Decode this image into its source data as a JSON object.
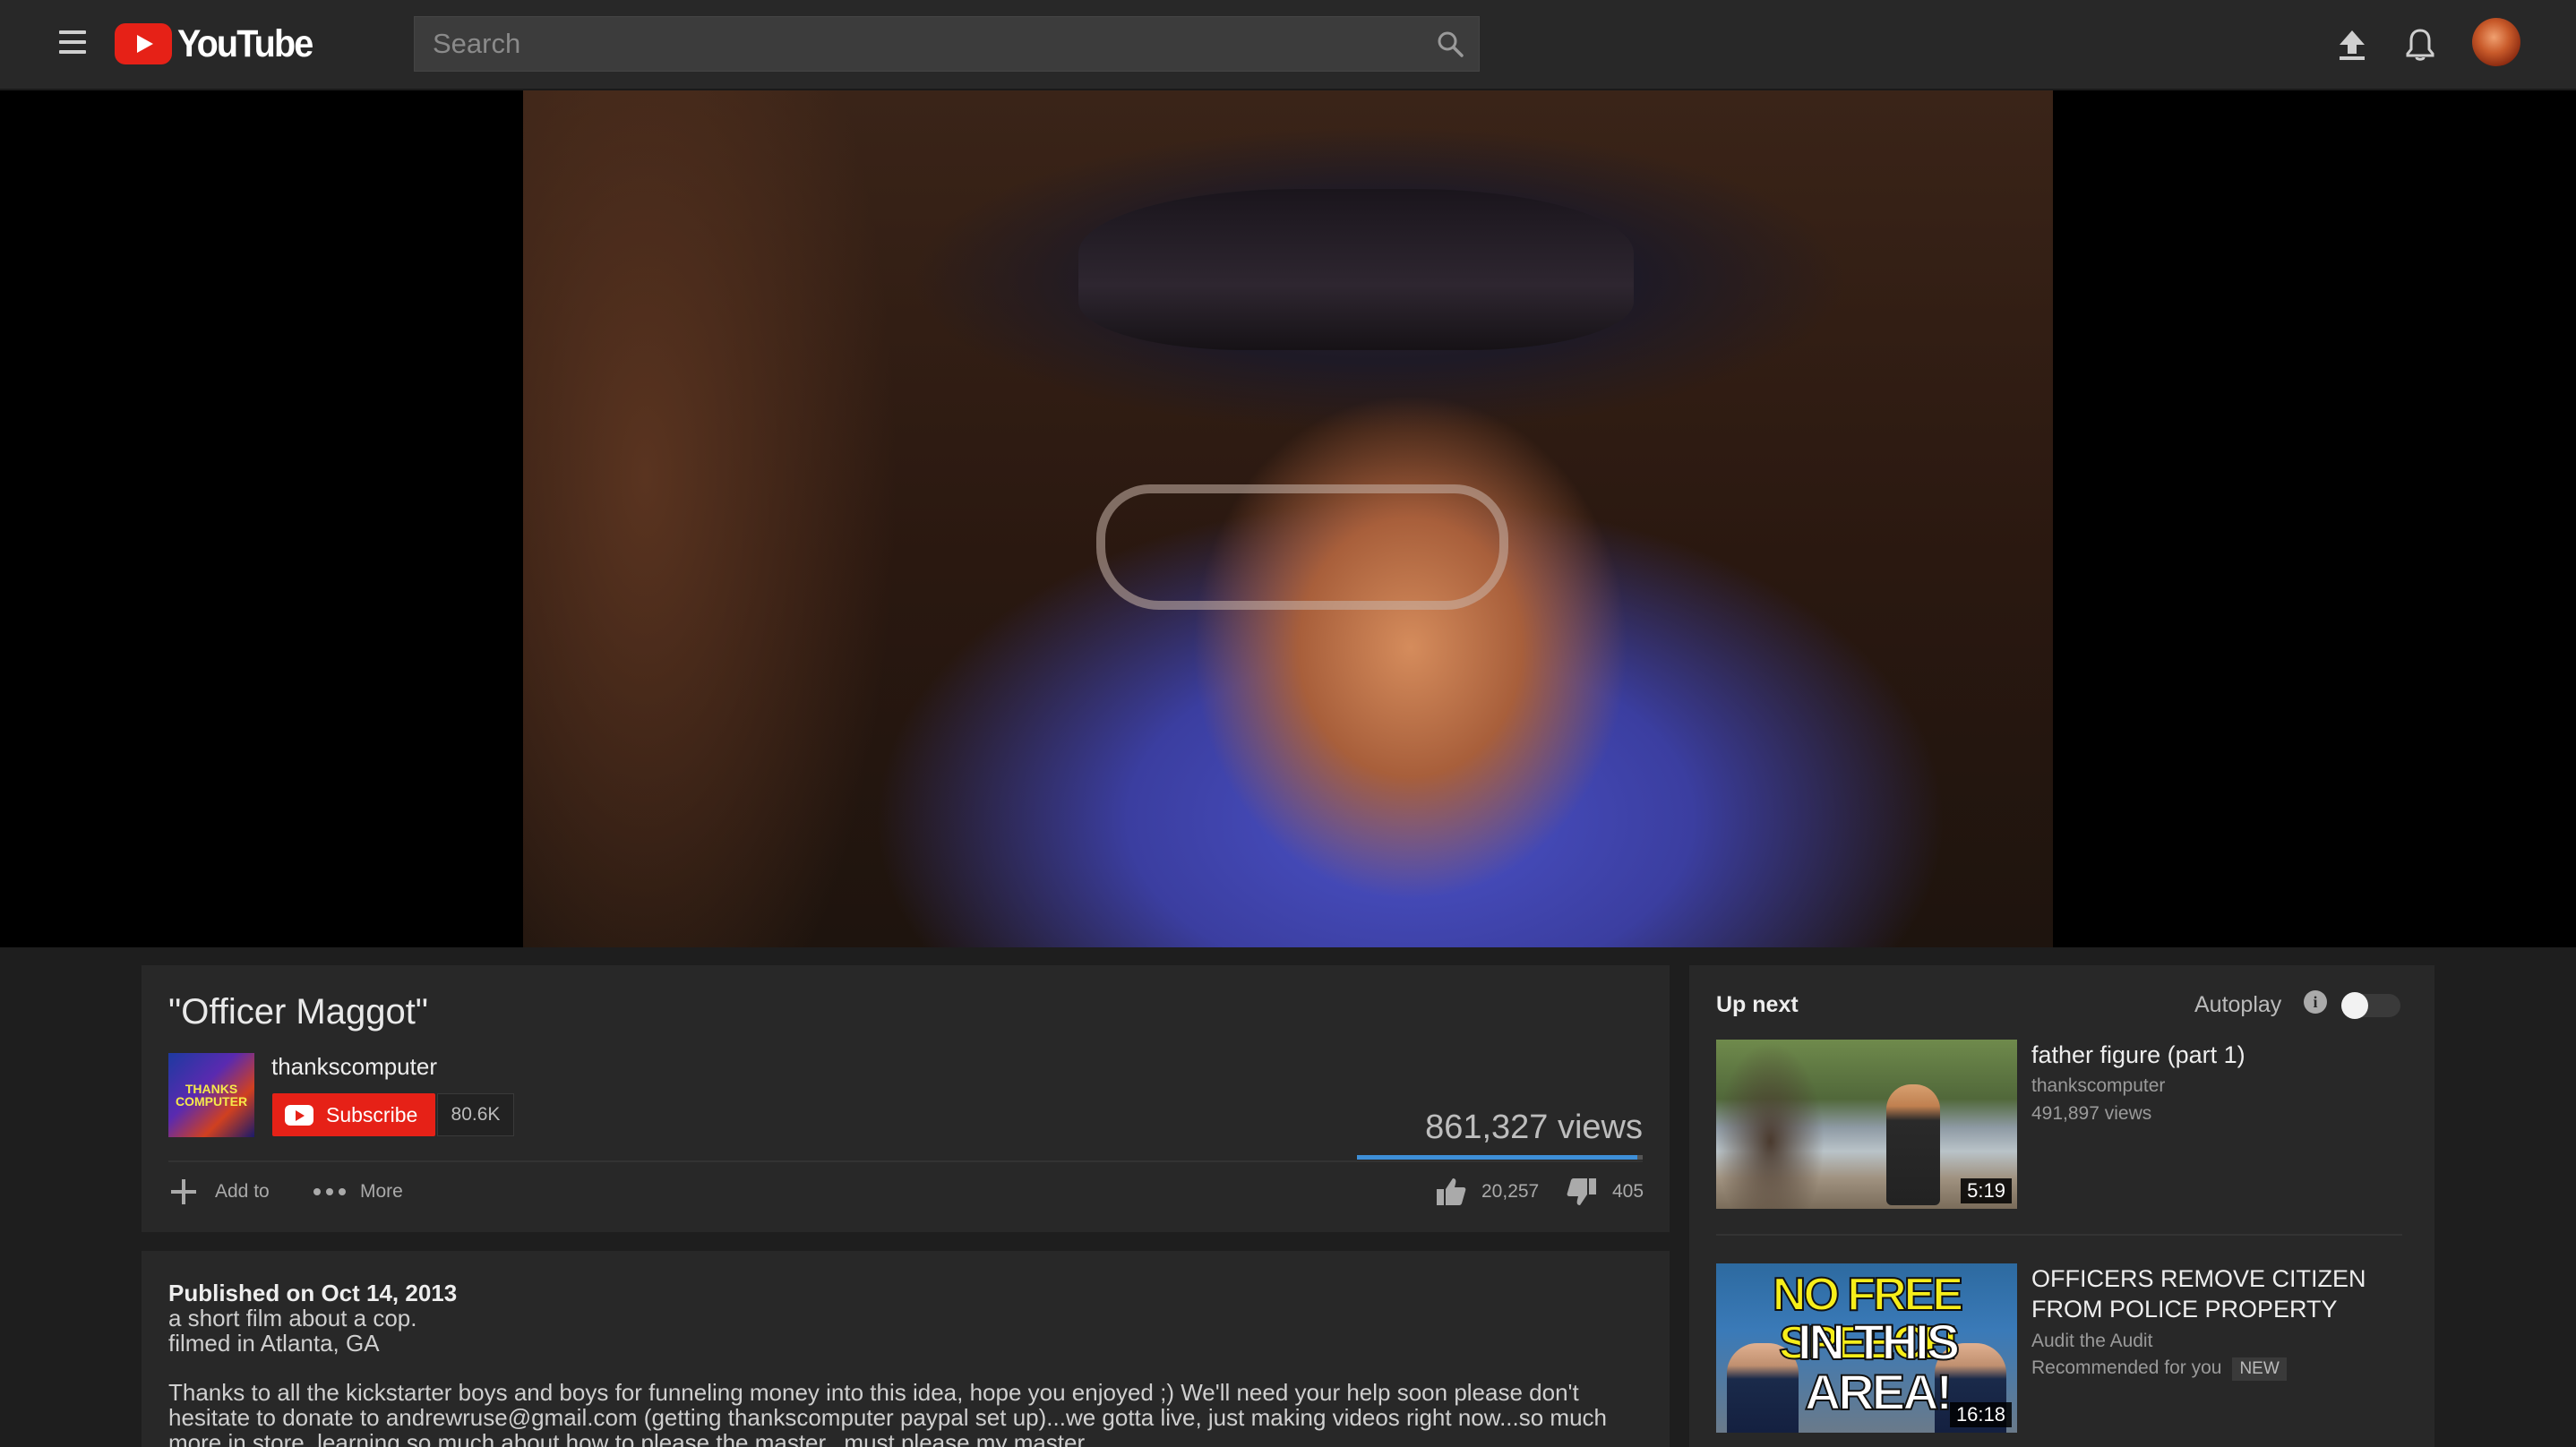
{
  "header": {
    "logo_text": "YouTube",
    "search_placeholder": "Search"
  },
  "video": {
    "title": "\"Officer Maggot\"",
    "channel": "thankscomputer",
    "channel_thumb_text": "THANKS COMPUTER",
    "subscribe_label": "Subscribe",
    "subscriber_count": "80.6K",
    "views": "861,327 views",
    "add_to_label": "Add to",
    "more_label": "More",
    "likes": "20,257",
    "dislikes": "405",
    "like_ratio": 0.98
  },
  "description": {
    "published": "Published on Oct 14, 2013",
    "lines": [
      "a short film about a cop.",
      "filmed in Atlanta, GA",
      "Thanks to all the kickstarter boys and boys for funneling money into this idea, hope you enjoyed ;) We'll need your help soon please don't",
      "hesitate to donate to andrewruse@gmail.com (getting thankscomputer paypal set up)...we gotta live, just making videos right now...so much",
      "more in store, learning so much about how to please the master...must please my master..."
    ]
  },
  "sidebar": {
    "up_next_label": "Up next",
    "autoplay_label": "Autoplay",
    "autoplay_on": false,
    "items": [
      {
        "title": "father figure (part 1)",
        "channel": "thankscomputer",
        "meta": "491,897 views",
        "duration": "5:19"
      },
      {
        "title": "OFFICERS REMOVE CITIZEN FROM POLICE PROPERTY",
        "channel": "Audit the Audit",
        "meta": "Recommended for you",
        "badge": "NEW",
        "duration": "16:18",
        "thumb_text_1": "NO FREE SPEECH",
        "thumb_text_2": "IN THIS AREA!"
      }
    ]
  },
  "icons": {
    "menu": "hamburger-icon",
    "search": "search-icon",
    "upload": "upload-icon",
    "notifications": "bell-icon",
    "add": "plus-icon",
    "more": "ellipsis-icon",
    "like": "thumbs-up-icon",
    "dislike": "thumbs-down-icon",
    "info": "info-icon"
  },
  "colors": {
    "brand_red": "#e62117",
    "sentiment_blue": "#3e8fd8"
  }
}
